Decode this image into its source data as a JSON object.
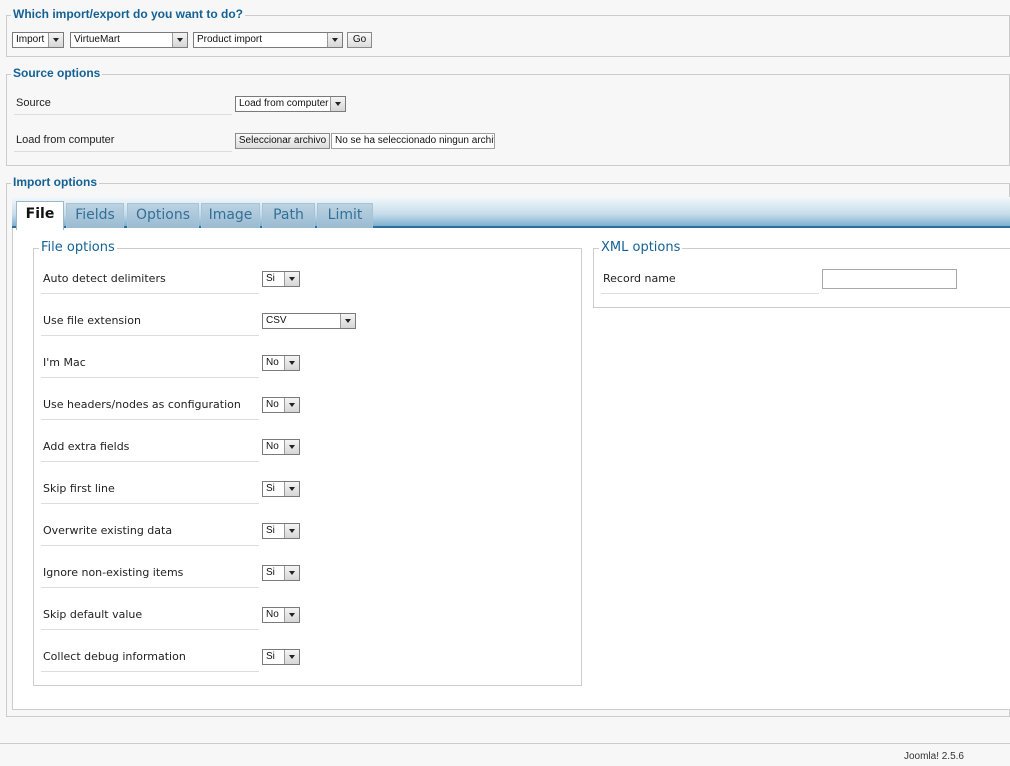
{
  "header": {
    "title": "Which import/export do you want to do?",
    "action_value": "Import",
    "component_value": "VirtueMart",
    "template_value": "Product import",
    "go_label": "Go"
  },
  "source_options": {
    "title": "Source options",
    "source_label": "Source",
    "source_value": "Load from computer",
    "load_label": "Load from computer",
    "file_button_label": "Seleccionar archivo",
    "file_status": "No se ha seleccionado ningun archivo"
  },
  "import_options": {
    "title": "Import options",
    "tabs": [
      {
        "label": "File"
      },
      {
        "label": "Fields"
      },
      {
        "label": "Options"
      },
      {
        "label": "Image"
      },
      {
        "label": "Path"
      },
      {
        "label": "Limit"
      }
    ]
  },
  "file_options": {
    "title": "File options",
    "rows": [
      {
        "label": "Auto detect delimiters",
        "value": "Si"
      },
      {
        "label": "Use file extension",
        "value": "CSV"
      },
      {
        "label": "I'm Mac",
        "value": "No"
      },
      {
        "label": "Use headers/nodes as configuration",
        "value": "No"
      },
      {
        "label": "Add extra fields",
        "value": "No"
      },
      {
        "label": "Skip first line",
        "value": "Si"
      },
      {
        "label": "Overwrite existing data",
        "value": "Si"
      },
      {
        "label": "Ignore non-existing items",
        "value": "Si"
      },
      {
        "label": "Skip default value",
        "value": "No"
      },
      {
        "label": "Collect debug information",
        "value": "Si"
      }
    ]
  },
  "xml_options": {
    "title": "XML options",
    "record_name_label": "Record name",
    "record_name_value": ""
  },
  "footer": {
    "version": "Joomla! 2.5.6"
  }
}
